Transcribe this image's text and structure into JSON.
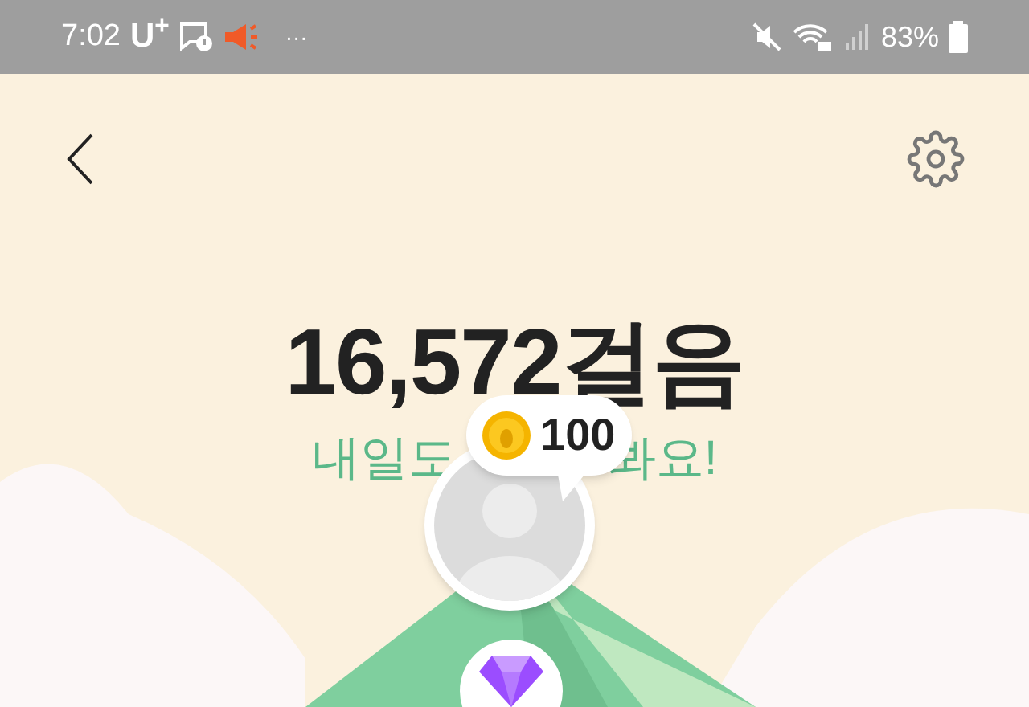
{
  "status_bar": {
    "time": "7:02",
    "carrier": "U$^{+}$",
    "more": "···",
    "battery": "83%"
  },
  "steps": {
    "count": "16,572걸음",
    "message_left": "내일도",
    "message_right": "봐요!"
  },
  "reward_bubble": {
    "amount": "100"
  }
}
